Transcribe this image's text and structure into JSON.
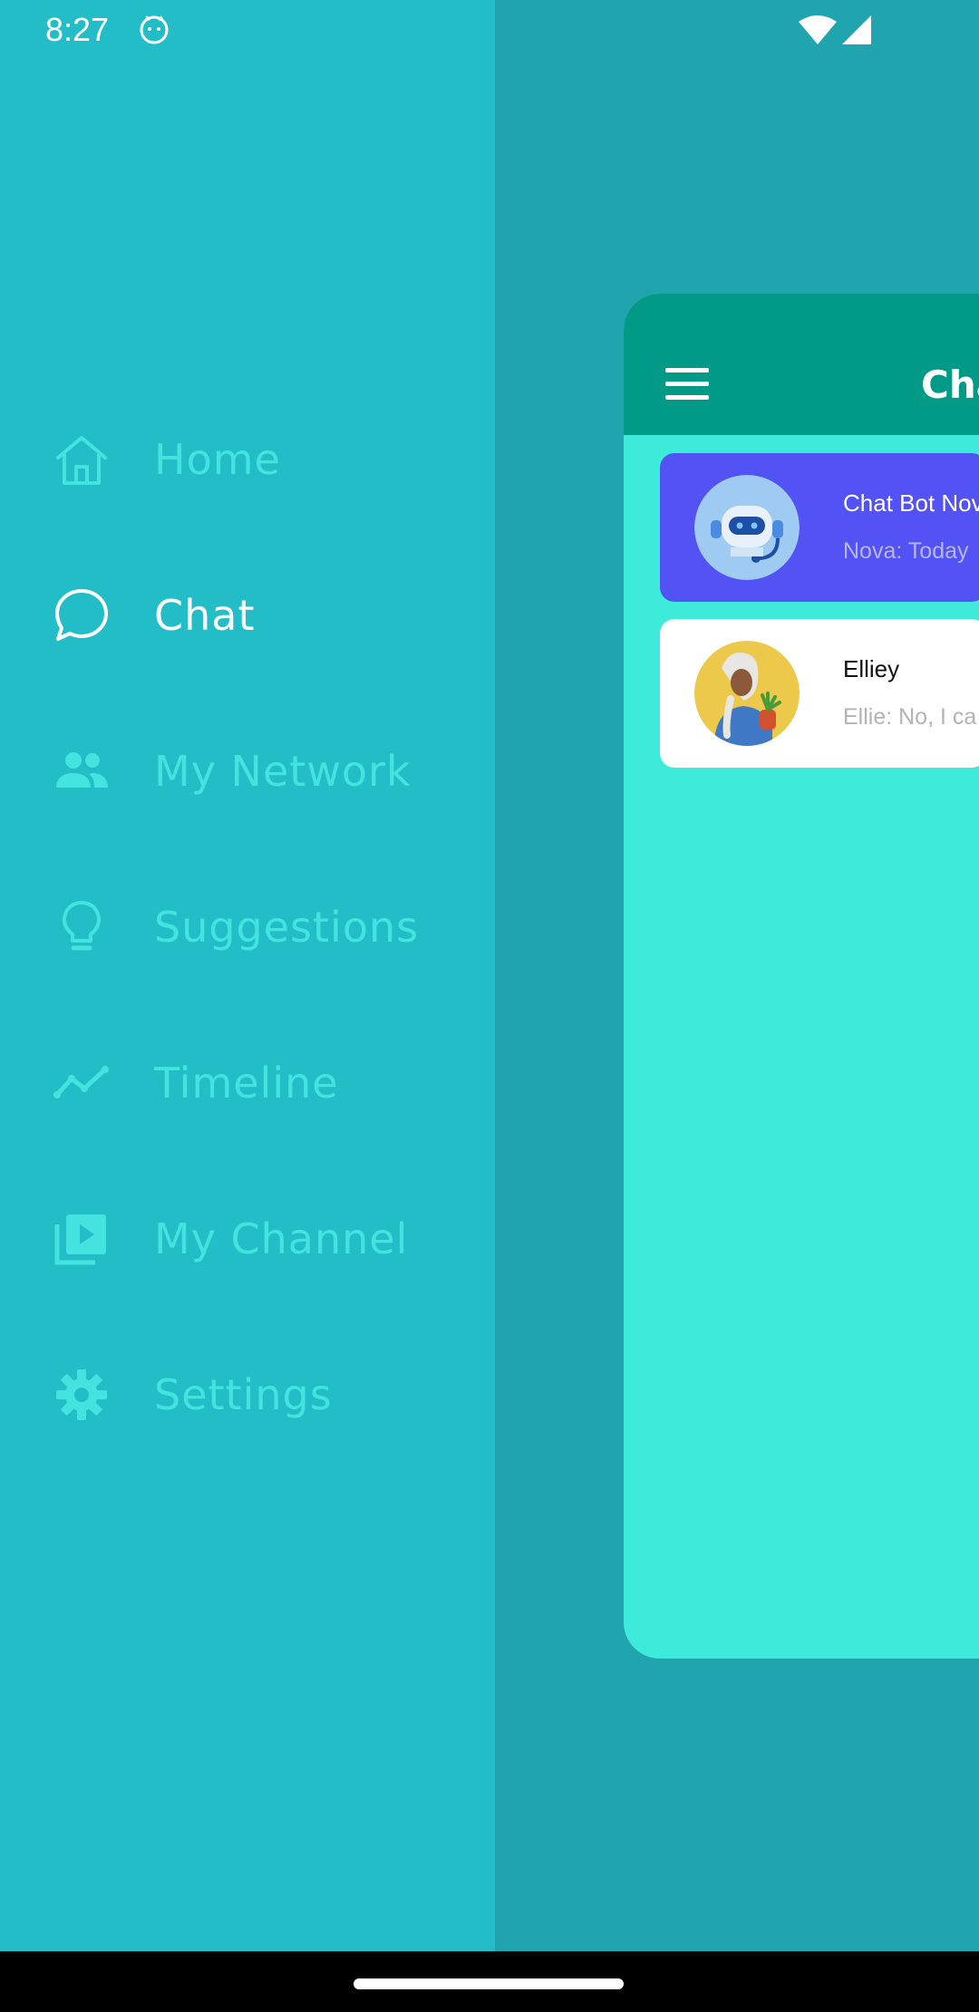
{
  "status_bar": {
    "time": "8:27"
  },
  "drawer": {
    "items": [
      {
        "label": "Home",
        "icon": "home-icon",
        "active": false
      },
      {
        "label": "Chat",
        "icon": "chat-bubble-icon",
        "active": true
      },
      {
        "label": "My Network",
        "icon": "people-icon",
        "active": false
      },
      {
        "label": "Suggestions",
        "icon": "lightbulb-icon",
        "active": false
      },
      {
        "label": "Timeline",
        "icon": "timeline-icon",
        "active": false
      },
      {
        "label": "My Channel",
        "icon": "video-library-icon",
        "active": false
      },
      {
        "label": "Settings",
        "icon": "gear-icon",
        "active": false
      }
    ]
  },
  "panel": {
    "title": "Cha",
    "chats": [
      {
        "name": "Chat Bot Nov",
        "preview": "Nova: Today",
        "avatar": "robot-avatar"
      },
      {
        "name": "Elliey",
        "preview": "Ellie: No, I ca",
        "avatar": "person-avatar"
      }
    ]
  },
  "colors": {
    "drawer_bg": "#22bdc7",
    "main_bg": "#20a4ae",
    "menu_text": "#45e3df",
    "active_text": "#ffffff",
    "panel_bg": "#3eebda",
    "header_bg": "#019a87",
    "bot_card": "#5352f4"
  }
}
